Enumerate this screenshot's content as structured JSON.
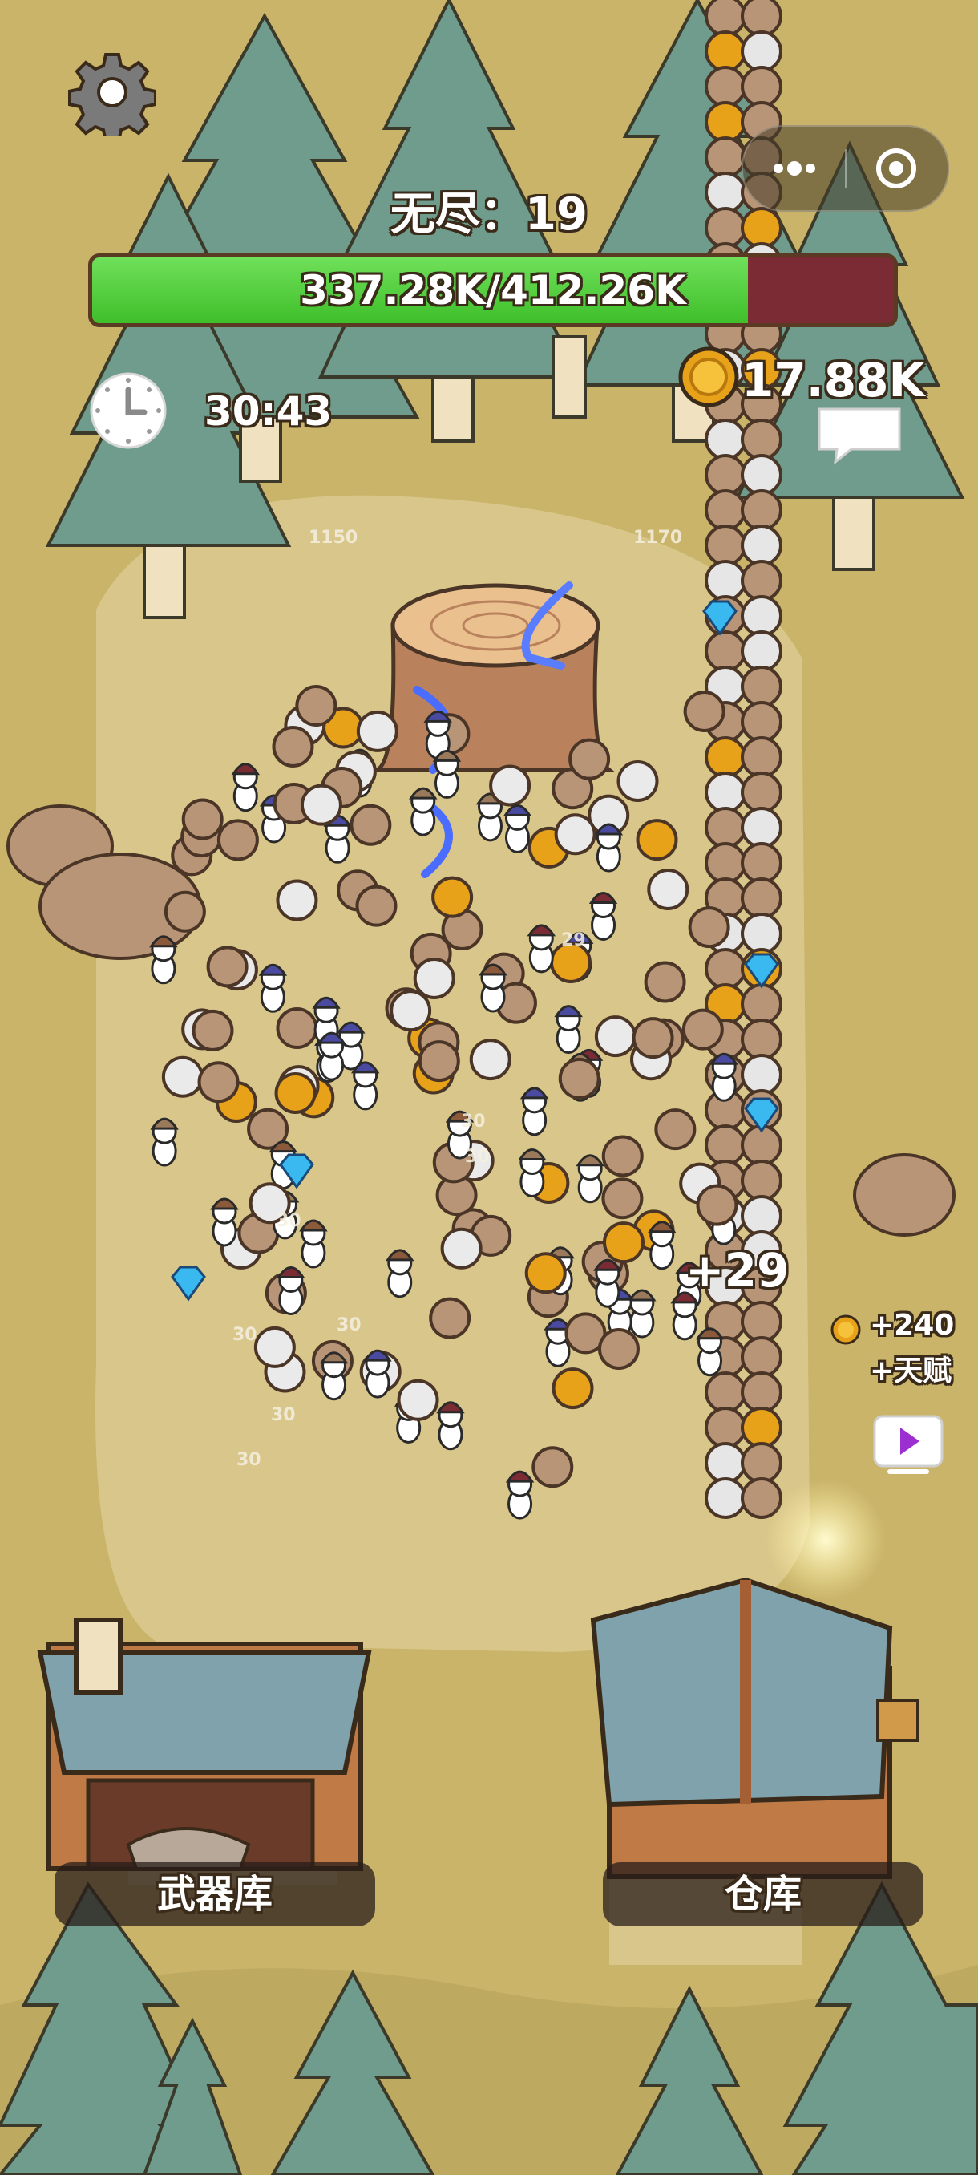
{
  "hud": {
    "mode_title": "无尽：19",
    "boss_hp_text": "337.28K/412.26K",
    "boss_hp_fraction": 0.818,
    "timer": "30:43",
    "coins": "17.88K",
    "settings_icon": "gear-icon",
    "timer_icon": "clock-icon",
    "coin_icon": "gold-coin-icon"
  },
  "mini_program_capsule": {
    "more_icon": "more-dots-icon",
    "close_icon": "close-target-icon"
  },
  "popups": {
    "gain": "+29",
    "reward_amount": "+240",
    "reward_talent": "+天赋"
  },
  "damage_numbers": [
    "1150",
    "1170",
    "29",
    "30",
    "30",
    "30",
    "30",
    "30",
    "30",
    "30"
  ],
  "buildings": {
    "armory_label": "武器库",
    "warehouse_label": "仓库"
  },
  "colors": {
    "hp_fill": "#4fcf3a",
    "hp_empty": "#7a2b33",
    "ground": "#c9b46a",
    "path": "#dcc98a",
    "tree": "#6f9c8c"
  }
}
